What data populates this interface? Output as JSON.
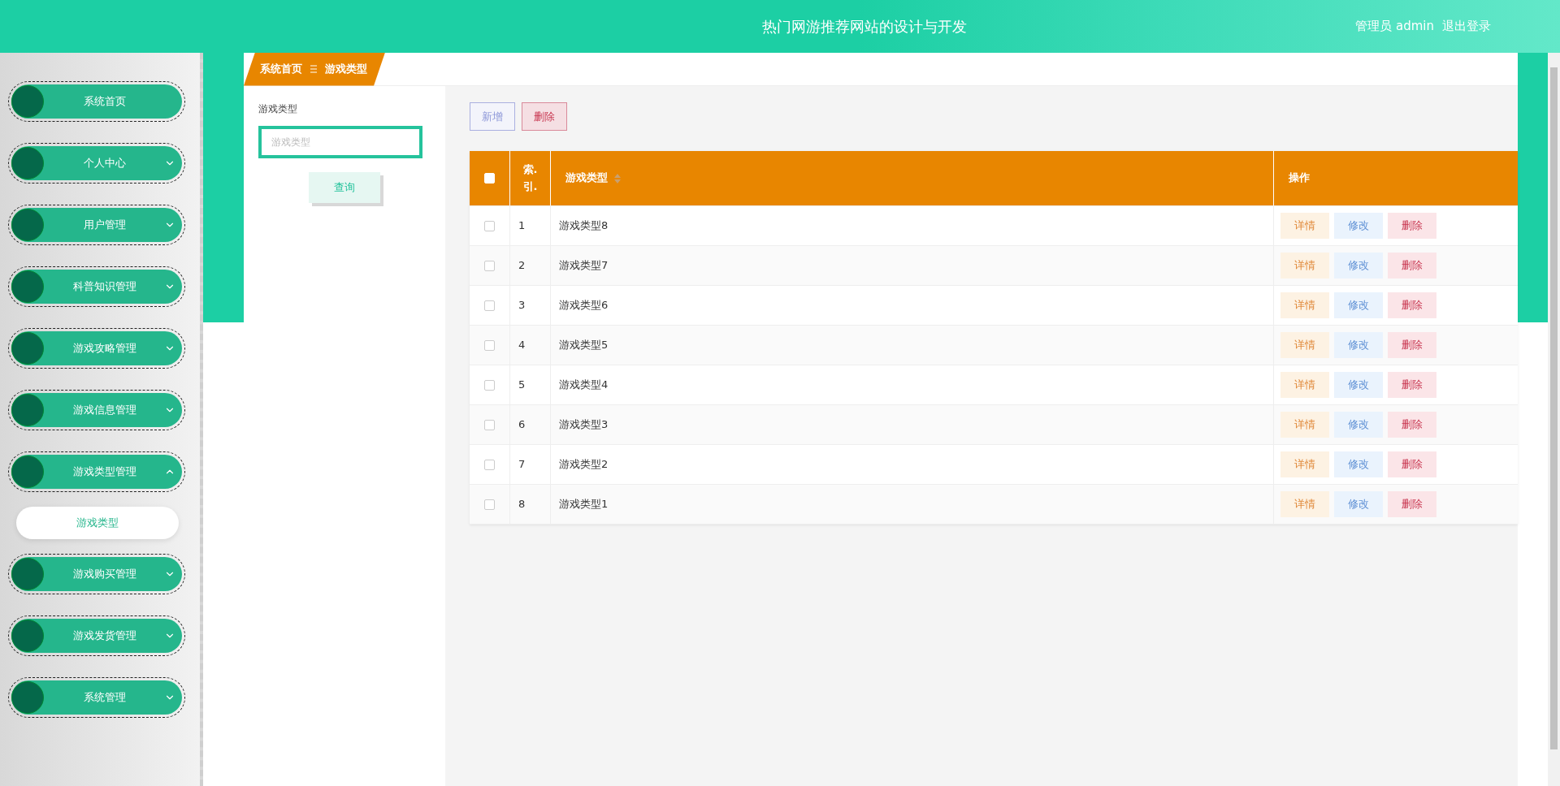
{
  "header": {
    "title": "热门网游推荐网站的设计与开发",
    "user": "管理员 admin",
    "logout": "退出登录"
  },
  "sidebar": {
    "items": [
      {
        "kind": "link",
        "label": "系统首页"
      },
      {
        "kind": "menu",
        "label": "个人中心",
        "expanded": false
      },
      {
        "kind": "menu",
        "label": "用户管理",
        "expanded": false
      },
      {
        "kind": "menu",
        "label": "科普知识管理",
        "expanded": false
      },
      {
        "kind": "menu",
        "label": "游戏攻略管理",
        "expanded": false
      },
      {
        "kind": "menu",
        "label": "游戏信息管理",
        "expanded": false
      },
      {
        "kind": "menu",
        "label": "游戏类型管理",
        "expanded": true,
        "children": [
          {
            "label": "游戏类型",
            "selected": true
          }
        ]
      },
      {
        "kind": "menu",
        "label": "游戏购买管理",
        "expanded": false
      },
      {
        "kind": "menu",
        "label": "游戏发货管理",
        "expanded": false
      },
      {
        "kind": "menu",
        "label": "系统管理",
        "expanded": false
      }
    ]
  },
  "breadcrumb": [
    "系统首页",
    "游戏类型"
  ],
  "search": {
    "label": "游戏类型",
    "placeholder": "游戏类型",
    "button": "查询"
  },
  "toolbar": {
    "add": "新增",
    "delete": "删除"
  },
  "table": {
    "select_all": {
      "checked": false
    },
    "columns": [
      "索.\n引.",
      "游戏类型",
      "操作"
    ],
    "rows": [
      {
        "checked": false,
        "index": "1",
        "name": "游戏类型8",
        "actions": [
          "详情",
          "修改",
          "删除"
        ]
      },
      {
        "checked": false,
        "index": "2",
        "name": "游戏类型7",
        "actions": [
          "详情",
          "修改",
          "删除"
        ]
      },
      {
        "checked": false,
        "index": "3",
        "name": "游戏类型6",
        "actions": [
          "详情",
          "修改",
          "删除"
        ]
      },
      {
        "checked": false,
        "index": "4",
        "name": "游戏类型5",
        "actions": [
          "详情",
          "修改",
          "删除"
        ]
      },
      {
        "checked": false,
        "index": "5",
        "name": "游戏类型4",
        "actions": [
          "详情",
          "修改",
          "删除"
        ]
      },
      {
        "checked": false,
        "index": "6",
        "name": "游戏类型3",
        "actions": [
          "详情",
          "修改",
          "删除"
        ]
      },
      {
        "checked": false,
        "index": "7",
        "name": "游戏类型2",
        "actions": [
          "详情",
          "修改",
          "删除"
        ]
      },
      {
        "checked": false,
        "index": "8",
        "name": "游戏类型1",
        "actions": [
          "详情",
          "修改",
          "删除"
        ]
      }
    ]
  }
}
